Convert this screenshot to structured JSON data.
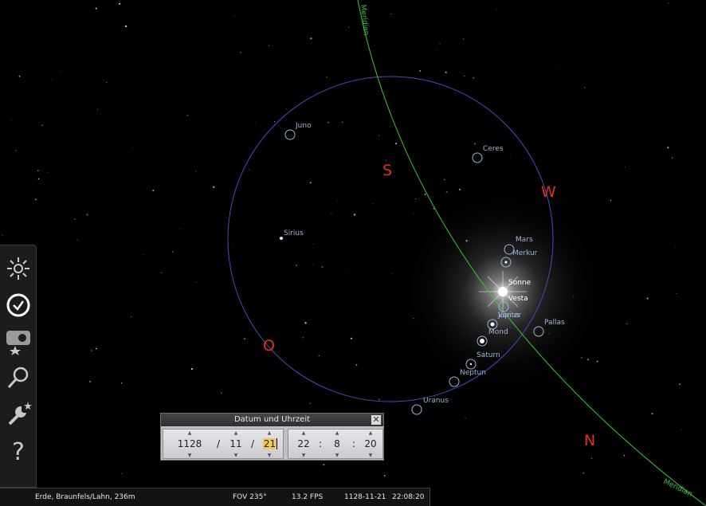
{
  "sky": {
    "meridian_label": "Meridian",
    "cardinals": {
      "south": "S",
      "west": "W",
      "north": "N",
      "east": "O"
    },
    "objects": [
      {
        "id": "juno",
        "label": "Juno"
      },
      {
        "id": "ceres",
        "label": "Ceres"
      },
      {
        "id": "sirius",
        "label": "Sirius"
      },
      {
        "id": "mars",
        "label": "Mars"
      },
      {
        "id": "merkur",
        "label": "Merkur"
      },
      {
        "id": "sonne",
        "label": "Sonne"
      },
      {
        "id": "vesta",
        "label": "Vesta"
      },
      {
        "id": "venus",
        "label": "Venus"
      },
      {
        "id": "jupiter",
        "label": "Jupiter"
      },
      {
        "id": "pallas",
        "label": "Pallas"
      },
      {
        "id": "mond",
        "label": "Mond"
      },
      {
        "id": "saturn",
        "label": "Saturn"
      },
      {
        "id": "neptun",
        "label": "Neptun"
      },
      {
        "id": "uranus",
        "label": "Uranus"
      }
    ]
  },
  "toolbar": {
    "items": [
      {
        "id": "sky-viewing-options",
        "icon": "sky-settings-icon"
      },
      {
        "id": "date-time",
        "icon": "clock-icon"
      },
      {
        "id": "location",
        "icon": "location-icon"
      },
      {
        "id": "search",
        "icon": "search-icon"
      },
      {
        "id": "configuration",
        "icon": "wrench-icon"
      },
      {
        "id": "help",
        "icon": "help-icon"
      }
    ]
  },
  "dialog": {
    "title": "Datum und Uhrzeit",
    "close": "✕",
    "date": {
      "year": "1128",
      "month": "11",
      "day": "21",
      "sep": "/"
    },
    "time": {
      "hour": "22",
      "minute": "8",
      "second": "20",
      "sep": ":"
    }
  },
  "status": {
    "location": "Erde, Braunfels/Lahn, 236m",
    "fov": "FOV 235°",
    "fps": "13.2 FPS",
    "date": "1128-11-21",
    "time": "22:08:20"
  },
  "colors": {
    "meridian": "#3ec43e",
    "horizon_circle": "#4a4ab8",
    "cardinal": "#e0301e",
    "planet_label": "#9fb3d9",
    "active_field": "#f0c65a"
  }
}
